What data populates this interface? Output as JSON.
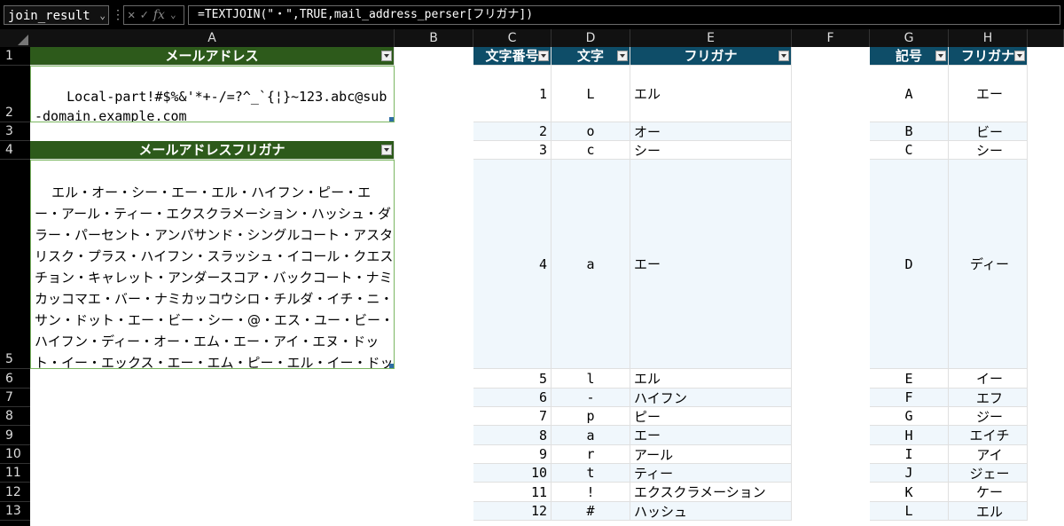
{
  "formula_bar": {
    "name_box": "join_result",
    "formula": "=TEXTJOIN(\"・\",TRUE,mail_address_perser[フリガナ])"
  },
  "columns": [
    "A",
    "B",
    "C",
    "D",
    "E",
    "F",
    "G",
    "H",
    ""
  ],
  "rows": [
    "1",
    "2",
    "3",
    "4",
    "5",
    "6",
    "7",
    "8",
    "9",
    "10",
    "11",
    "12",
    "13"
  ],
  "table_a": {
    "header1": "メールアドレス",
    "email": "Local-part!#$%&'*+-/=?^_`{¦}~123.abc@sub-domain.example.com",
    "header2": "メールアドレスフリガナ",
    "furigana": "エル・オー・シー・エー・エル・ハイフン・ピー・エー・アール・ティー・エクスクラメーション・ハッシュ・ダラー・パーセント・アンパサンド・シングルコート・アスタリスク・プラス・ハイフン・スラッシュ・イコール・クエスチョン・キャレット・アンダースコア・バックコート・ナミカッコマエ・バー・ナミカッコウシロ・チルダ・イチ・ニ・サン・ドット・エー・ビー・シー・@・エス・ユー・ビー・ハイフン・ディー・オー・エム・エー・アイ・エヌ・ドット・イー・エックス・エー・エム・ピー・エル・イー・ドット・シー・オー・エム"
  },
  "table_c": {
    "headers": [
      "文字番号",
      "文字",
      "フリガナ"
    ],
    "rows": [
      [
        "1",
        "L",
        "エル"
      ],
      [
        "2",
        "o",
        "オー"
      ],
      [
        "3",
        "c",
        "シー"
      ],
      [
        "4",
        "a",
        "エー"
      ],
      [
        "5",
        "l",
        "エル"
      ],
      [
        "6",
        "-",
        "ハイフン"
      ],
      [
        "7",
        "p",
        "ピー"
      ],
      [
        "8",
        "a",
        "エー"
      ],
      [
        "9",
        "r",
        "アール"
      ],
      [
        "10",
        "t",
        "ティー"
      ],
      [
        "11",
        "!",
        "エクスクラメーション"
      ],
      [
        "12",
        "#",
        "ハッシュ"
      ]
    ]
  },
  "table_g": {
    "headers": [
      "記号",
      "フリガナ"
    ],
    "rows": [
      [
        "A",
        "エー"
      ],
      [
        "B",
        "ビー"
      ],
      [
        "C",
        "シー"
      ],
      [
        "D",
        "ディー"
      ],
      [
        "E",
        "イー"
      ],
      [
        "F",
        "エフ"
      ],
      [
        "G",
        "ジー"
      ],
      [
        "H",
        "エイチ"
      ],
      [
        "I",
        "アイ"
      ],
      [
        "J",
        "ジェー"
      ],
      [
        "K",
        "ケー"
      ],
      [
        "L",
        "エル"
      ]
    ]
  }
}
